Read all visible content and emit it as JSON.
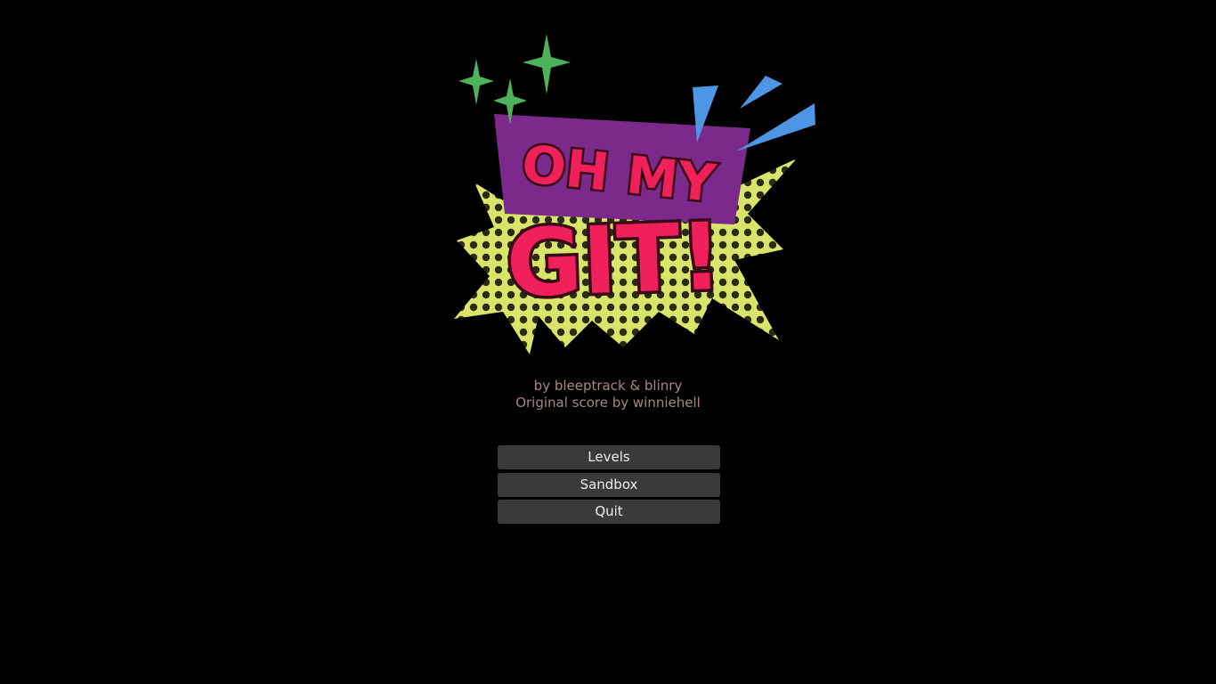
{
  "credits": {
    "line1": "by bleeptrack & blinry",
    "line2": "Original score by winniehell"
  },
  "menu": {
    "items": [
      {
        "label": "Levels"
      },
      {
        "label": "Sandbox"
      },
      {
        "label": "Quit"
      }
    ]
  },
  "logo": {
    "line1": "OH MY",
    "line2": "GIT!"
  },
  "colors": {
    "background": "#000000",
    "logo_purple": "#7b2a8c",
    "logo_pink": "#f0205a",
    "logo_yellow": "#d9e56a",
    "sparkle_green": "#4db35a",
    "shard_blue": "#4d96e6",
    "button_bg": "#3a3a3a",
    "credit_text": "#a98686"
  }
}
